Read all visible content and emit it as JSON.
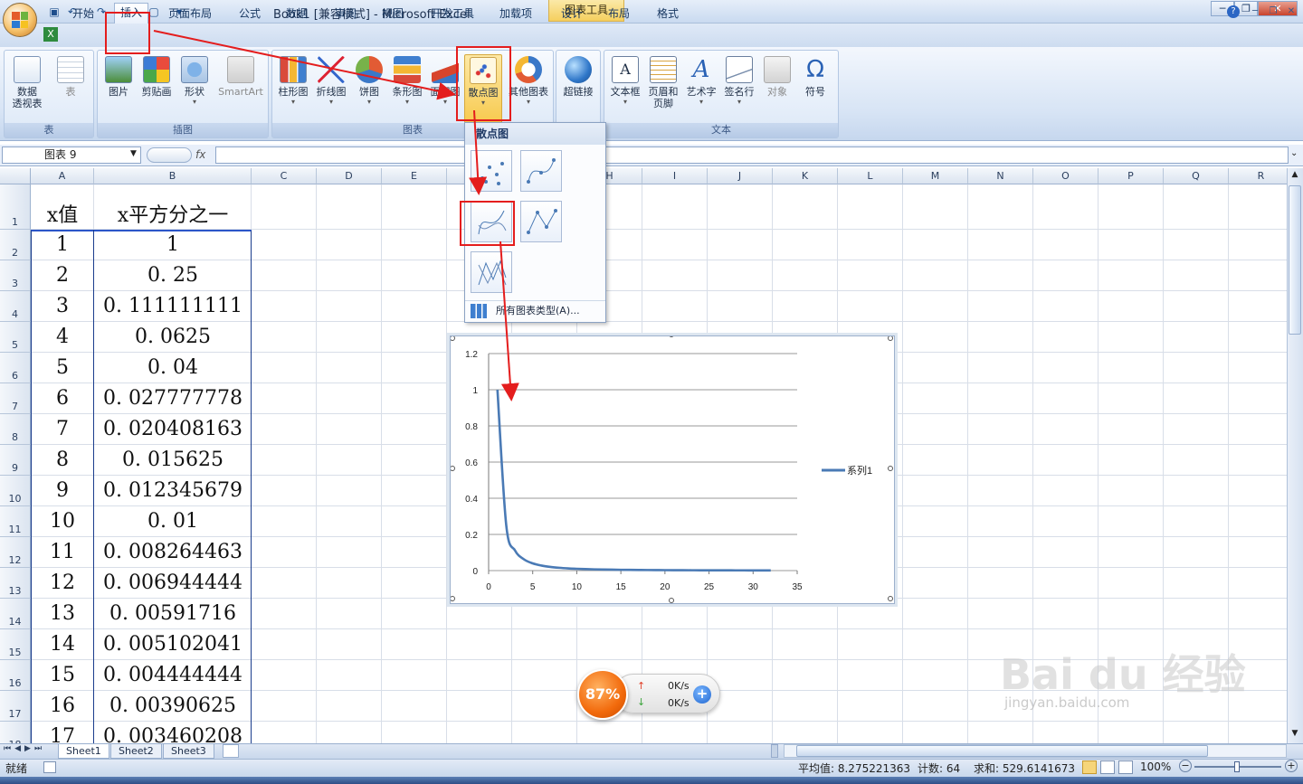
{
  "title": {
    "doc": "Book1  [兼容模式] - Microsoft Excel",
    "tools": "图表工具",
    "min": "─",
    "max": "❐",
    "close": "✕"
  },
  "tabs": [
    "开始",
    "插入",
    "页面布局",
    "公式",
    "数据",
    "审阅",
    "视图",
    "开发工具",
    "加载项",
    "设计",
    "布局",
    "格式"
  ],
  "ribbon": {
    "groups": {
      "table": "表",
      "illus": "插图",
      "charts": "图表",
      "links": "",
      "text": "文本"
    },
    "buttons": {
      "pivot": "数据\n透视表",
      "table": "表",
      "picture": "图片",
      "clipart": "剪贴画",
      "shapes": "形状",
      "smartart": "SmartArt",
      "col": "柱形图",
      "line": "折线图",
      "pie": "饼图",
      "bar": "条形图",
      "area": "面积图",
      "scatter": "散点图",
      "other": "其他图表",
      "hyperlink": "超链接",
      "textbox": "文本框",
      "header": "页眉和\n页脚",
      "wordart": "艺术字",
      "signature": "签名行",
      "object": "对象",
      "symbol": "符号"
    }
  },
  "namebox": "图表 9",
  "fx": "fx",
  "columns": [
    "A",
    "B",
    "C",
    "D",
    "E",
    "F",
    "G",
    "H",
    "I",
    "J",
    "K",
    "L",
    "M",
    "N",
    "O",
    "P",
    "Q",
    "R"
  ],
  "rows": [
    "1",
    "2",
    "3",
    "4",
    "5",
    "6",
    "7",
    "8",
    "9",
    "10",
    "11",
    "12",
    "13",
    "14",
    "15",
    "16",
    "17",
    "18"
  ],
  "table": {
    "headers": [
      "x值",
      "x平方分之一"
    ],
    "data": [
      [
        "1",
        "1"
      ],
      [
        "2",
        "0. 25"
      ],
      [
        "3",
        "0. 111111111"
      ],
      [
        "4",
        "0. 0625"
      ],
      [
        "5",
        "0. 04"
      ],
      [
        "6",
        "0. 027777778"
      ],
      [
        "7",
        "0. 020408163"
      ],
      [
        "8",
        "0. 015625"
      ],
      [
        "9",
        "0. 012345679"
      ],
      [
        "10",
        "0. 01"
      ],
      [
        "11",
        "0. 008264463"
      ],
      [
        "12",
        "0. 006944444"
      ],
      [
        "13",
        "0. 00591716"
      ],
      [
        "14",
        "0. 005102041"
      ],
      [
        "15",
        "0. 004444444"
      ],
      [
        "16",
        "0. 00390625"
      ],
      [
        "17",
        "0. 003460208"
      ]
    ]
  },
  "menu": {
    "title": "散点图",
    "footer": "所有图表类型(A)..."
  },
  "chart_data": {
    "type": "line",
    "title": "",
    "series": [
      {
        "name": "系列1",
        "color": "#4a7ab5",
        "x": [
          1,
          2,
          3,
          4,
          5,
          6,
          7,
          8,
          9,
          10,
          11,
          12,
          13,
          14,
          15,
          16,
          17,
          18,
          19,
          20,
          21,
          22,
          23,
          24,
          25,
          26,
          27,
          28,
          29,
          30,
          31,
          32
        ],
        "y": [
          1,
          0.25,
          0.111,
          0.0625,
          0.04,
          0.0278,
          0.0204,
          0.0156,
          0.0123,
          0.01,
          0.0083,
          0.0069,
          0.0059,
          0.0051,
          0.0044,
          0.0039,
          0.0035,
          0.0031,
          0.0028,
          0.0025,
          0.0023,
          0.0021,
          0.0019,
          0.0017,
          0.0016,
          0.0015,
          0.0014,
          0.0013,
          0.0012,
          0.0011,
          0.001,
          0.001
        ]
      }
    ],
    "x_ticks": [
      "0",
      "5",
      "10",
      "15",
      "20",
      "25",
      "30",
      "35"
    ],
    "y_ticks": [
      "0",
      "0.2",
      "0.4",
      "0.6",
      "0.8",
      "1",
      "1.2"
    ],
    "xlim": [
      0,
      35
    ],
    "ylim": [
      0,
      1.2
    ],
    "grid": true,
    "legend": "right"
  },
  "sheets": [
    "Sheet1",
    "Sheet2",
    "Sheet3"
  ],
  "status": {
    "ready": "就绪",
    "avg": "平均值: 8.275221363",
    "count": "计数: 64",
    "sum": "求和: 529.6141673",
    "zoom": "100%"
  },
  "speed": {
    "percent": "87%",
    "up": "0K/s",
    "down": "0K/s"
  },
  "watermark": {
    "main": "Bai du 经验",
    "sub": "jingyan.baidu.com"
  }
}
